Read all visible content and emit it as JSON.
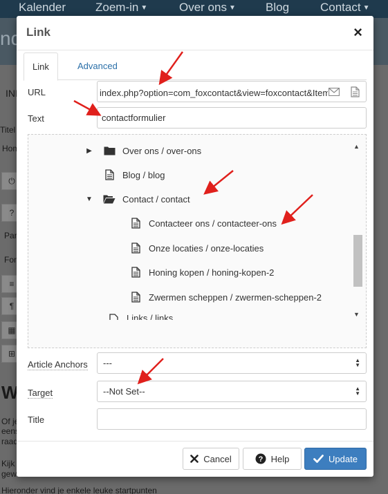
{
  "background": {
    "nav": [
      "Kalender",
      "Zoem-in",
      "Over ons",
      "Blog",
      "Contact"
    ],
    "fragments": {
      "brand": "nd",
      "tab": "INH",
      "titel": "Titel",
      "home": "Hom",
      "para": "Para",
      "font": "Font",
      "heading": "We",
      "line1": "Of je",
      "line2": "eens",
      "line3": "raad",
      "line4": "Kijk e",
      "line5": "gewo",
      "line6": "Hieronder vind je enkele leuke startpunten"
    }
  },
  "modal": {
    "title": "Link",
    "close": "×",
    "tabs": [
      "Link",
      "Advanced"
    ],
    "url": {
      "label": "URL",
      "value": "index.php?option=com_foxcontact&view=foxcontact&Itemid=",
      "icons": [
        "envelope-icon",
        "file-icon"
      ]
    },
    "text": {
      "label": "Text",
      "value": "contactformulier"
    },
    "tree": [
      {
        "label": "Over ons / over-ons",
        "type": "folder",
        "expander": "collapsed"
      },
      {
        "label": "Blog / blog",
        "type": "page",
        "expander": "none"
      },
      {
        "label": "Contact / contact",
        "type": "folder-open",
        "expander": "expanded"
      },
      {
        "label": "Contacteer ons / contacteer-ons",
        "type": "page",
        "expander": "none"
      },
      {
        "label": "Onze locaties / onze-locaties",
        "type": "page",
        "expander": "none"
      },
      {
        "label": "Honing kopen / honing-kopen-2",
        "type": "page",
        "expander": "none"
      },
      {
        "label": "Zwermen scheppen / zwermen-scheppen-2",
        "type": "page",
        "expander": "none"
      },
      {
        "label": "Links / links",
        "type": "page",
        "expander": "none"
      }
    ],
    "anchors": {
      "label": "Article Anchors",
      "value": "---"
    },
    "target": {
      "label": "Target",
      "value": "--Not Set--"
    },
    "title_field": {
      "label": "Title",
      "value": ""
    },
    "buttons": {
      "cancel": "Cancel",
      "help": "Help",
      "update": "Update"
    }
  },
  "colors": {
    "accent": "#3d7ebf",
    "link": "#2a6fa8",
    "annotation": "#e0201c",
    "nav_bg": "#1f3a4d"
  }
}
